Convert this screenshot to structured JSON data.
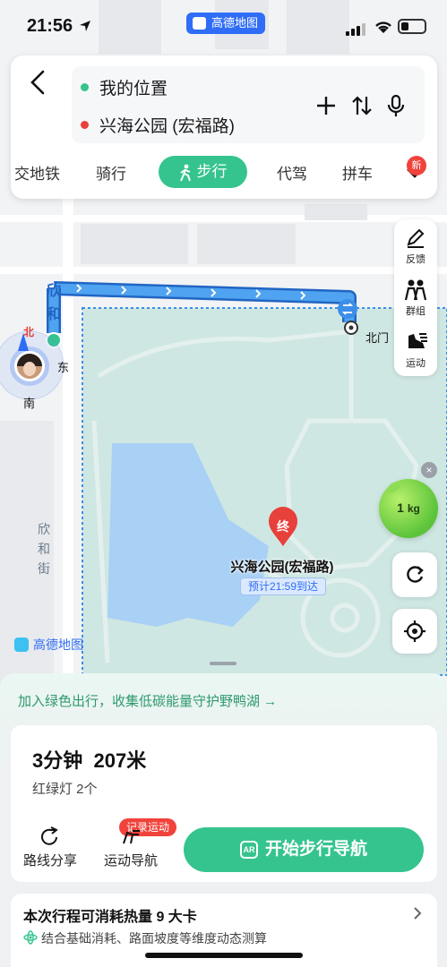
{
  "status_bar": {
    "time": "21:56",
    "app_pill": "高德地图"
  },
  "route_panel": {
    "from": "我的位置",
    "to": "兴海公园 (宏福路)",
    "modes": [
      "交地铁",
      "骑行",
      "步行",
      "代驾",
      "拼车"
    ],
    "active_mode": "步行",
    "new_badge": "新"
  },
  "side_tools": {
    "feedback": "反馈",
    "group": "群组",
    "sport": "运动"
  },
  "map": {
    "street_blue": [
      "欣",
      "和"
    ],
    "street_side": [
      "欣",
      "和",
      "街"
    ],
    "compass_north": "北",
    "compass_east": "东",
    "compass_south": "南",
    "gate_label": "北门",
    "destination_pin": "终",
    "destination_name": "兴海公园(宏福路)",
    "eta": "预计21:59到达",
    "eco_weight": "1",
    "eco_unit": "kg",
    "logo": "高德地图"
  },
  "sheet": {
    "green_tip": "加入绿色出行，收集低碳能量守护野鸭湖 →",
    "duration": "3分钟",
    "distance": "207米",
    "traffic_lights": "红绿灯 2个",
    "share_label": "路线分享",
    "sport_nav_label": "运动导航",
    "record_badge": "记录运动",
    "start_label": "开始步行导航",
    "ar_text": "AR",
    "calorie_title": "本次行程可消耗热量 9 大卡",
    "calorie_sub": "结合基础消耗、路面坡度等维度动态测算"
  },
  "colors": {
    "accent_green": "#35c48e",
    "route_blue": "#3d8ee8",
    "brand_blue": "#2f6df6",
    "alert_red": "#f0433c",
    "park_fill": "#cfe7e3"
  }
}
